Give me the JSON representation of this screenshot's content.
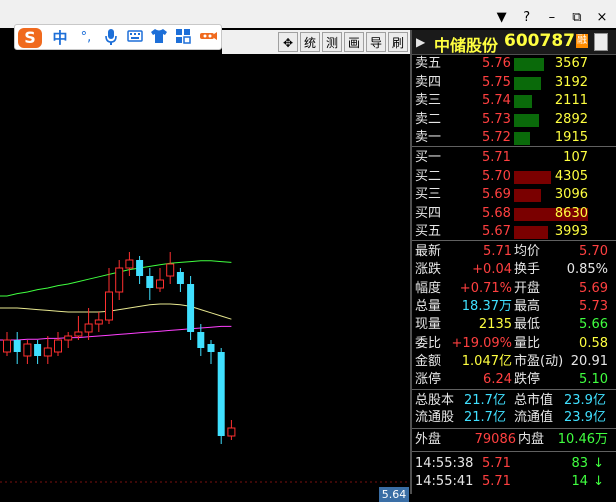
{
  "window": {
    "controls": [
      "▼",
      "?",
      "–",
      "⧉",
      "×"
    ]
  },
  "ime": {
    "logo": "S",
    "mode": "中",
    "punct": "°,",
    "mic": "mic-icon",
    "items": [
      "keyboard-icon",
      "shirt-icon",
      "grid-icon",
      "tool-icon"
    ]
  },
  "toolbar": {
    "buttons": [
      "✥",
      "统",
      "测",
      "画",
      "导",
      "刷"
    ]
  },
  "stock": {
    "name": "中储股份",
    "code": "600787",
    "badge": "融"
  },
  "order_book": {
    "asks": [
      {
        "label": "卖五",
        "price": "5.76",
        "vol": "3567",
        "fill": 0.41
      },
      {
        "label": "卖四",
        "price": "5.75",
        "vol": "3192",
        "fill": 0.37
      },
      {
        "label": "卖三",
        "price": "5.74",
        "vol": "2111",
        "fill": 0.24
      },
      {
        "label": "卖二",
        "price": "5.73",
        "vol": "2892",
        "fill": 0.34
      },
      {
        "label": "卖一",
        "price": "5.72",
        "vol": "1915",
        "fill": 0.22
      }
    ],
    "bids": [
      {
        "label": "买一",
        "price": "5.71",
        "vol": "107",
        "fill": 0.0
      },
      {
        "label": "买二",
        "price": "5.70",
        "vol": "4305",
        "fill": 0.5
      },
      {
        "label": "买三",
        "price": "5.69",
        "vol": "3096",
        "fill": 0.36
      },
      {
        "label": "买四",
        "price": "5.68",
        "vol": "8630",
        "fill": 1.0
      },
      {
        "label": "买五",
        "price": "5.67",
        "vol": "3993",
        "fill": 0.46
      }
    ]
  },
  "quote": {
    "rows": [
      {
        "l1": "最新",
        "v1": "5.71",
        "c1": "red",
        "l2": "均价",
        "v2": "5.70",
        "c2": "red"
      },
      {
        "l1": "涨跌",
        "v1": "+0.04",
        "c1": "red",
        "l2": "换手",
        "v2": "0.85%",
        "c2": "white"
      },
      {
        "l1": "幅度",
        "v1": "+0.71%",
        "c1": "red",
        "l2": "开盘",
        "v2": "5.69",
        "c2": "red"
      },
      {
        "l1": "总量",
        "v1": "18.37万",
        "c1": "cyan",
        "l2": "最高",
        "v2": "5.73",
        "c2": "red"
      },
      {
        "l1": "现量",
        "v1": "2135",
        "c1": "yellow",
        "l2": "最低",
        "v2": "5.66",
        "c2": "green"
      },
      {
        "l1": "委比",
        "v1": "+19.09%",
        "c1": "red",
        "l2": "量比",
        "v2": "0.58",
        "c2": "yellow"
      },
      {
        "l1": "金额",
        "v1": "1.047亿",
        "c1": "yellow",
        "l2": "市盈(动)",
        "v2": "20.91",
        "c2": "white"
      },
      {
        "l1": "涨停",
        "v1": "6.24",
        "c1": "red",
        "l2": "跌停",
        "v2": "5.10",
        "c2": "green"
      }
    ],
    "cap_rows": [
      {
        "l1": "总股本",
        "v1": "21.7亿",
        "l2": "总市值",
        "v2": "23.9亿"
      },
      {
        "l1": "流通股",
        "v1": "21.7亿",
        "l2": "流通值",
        "v2": "23.9亿"
      }
    ],
    "outer": {
      "label": "外盘",
      "value": "79086"
    },
    "inner": {
      "label": "内盘",
      "value": "10.46万"
    }
  },
  "ticks": [
    {
      "time": "14:55:38",
      "price": "5.71",
      "vol": "83",
      "arrow": "↓"
    },
    {
      "time": "14:55:41",
      "price": "5.71",
      "vol": "14",
      "arrow": "↓"
    }
  ],
  "chart_data": {
    "type": "candlestick",
    "current_price_label": "5.64",
    "ylim": [
      5.6,
      5.95
    ],
    "candles": [
      {
        "o": 5.765,
        "c": 5.78,
        "h": 5.79,
        "l": 5.76
      },
      {
        "o": 5.78,
        "c": 5.765,
        "h": 5.79,
        "l": 5.75
      },
      {
        "o": 5.76,
        "c": 5.775,
        "h": 5.78,
        "l": 5.75
      },
      {
        "o": 5.775,
        "c": 5.76,
        "h": 5.78,
        "l": 5.75
      },
      {
        "o": 5.76,
        "c": 5.77,
        "h": 5.785,
        "l": 5.75
      },
      {
        "o": 5.765,
        "c": 5.78,
        "h": 5.79,
        "l": 5.76
      },
      {
        "o": 5.78,
        "c": 5.785,
        "h": 5.79,
        "l": 5.77
      },
      {
        "o": 5.785,
        "c": 5.79,
        "h": 5.81,
        "l": 5.78
      },
      {
        "o": 5.79,
        "c": 5.8,
        "h": 5.82,
        "l": 5.78
      },
      {
        "o": 5.8,
        "c": 5.805,
        "h": 5.815,
        "l": 5.79
      },
      {
        "o": 5.805,
        "c": 5.84,
        "h": 5.87,
        "l": 5.8
      },
      {
        "o": 5.84,
        "c": 5.87,
        "h": 5.88,
        "l": 5.83
      },
      {
        "o": 5.87,
        "c": 5.88,
        "h": 5.89,
        "l": 5.86
      },
      {
        "o": 5.88,
        "c": 5.86,
        "h": 5.885,
        "l": 5.85
      },
      {
        "o": 5.86,
        "c": 5.845,
        "h": 5.87,
        "l": 5.83
      },
      {
        "o": 5.845,
        "c": 5.855,
        "h": 5.87,
        "l": 5.84
      },
      {
        "o": 5.86,
        "c": 5.875,
        "h": 5.89,
        "l": 5.85
      },
      {
        "o": 5.865,
        "c": 5.85,
        "h": 5.87,
        "l": 5.84
      },
      {
        "o": 5.85,
        "c": 5.79,
        "h": 5.86,
        "l": 5.78
      },
      {
        "o": 5.79,
        "c": 5.77,
        "h": 5.8,
        "l": 5.76
      },
      {
        "o": 5.775,
        "c": 5.765,
        "h": 5.78,
        "l": 5.75
      },
      {
        "o": 5.765,
        "c": 5.66,
        "h": 5.77,
        "l": 5.65
      },
      {
        "o": 5.66,
        "c": 5.67,
        "h": 5.68,
        "l": 5.655
      }
    ],
    "ma_lines": [
      {
        "color": "#40ff40",
        "values": [
          5.835,
          5.838,
          5.84,
          5.843,
          5.845,
          5.848,
          5.85,
          5.853,
          5.856,
          5.859,
          5.862,
          5.865,
          5.868,
          5.87,
          5.872,
          5.874,
          5.876,
          5.877,
          5.878,
          5.879,
          5.879,
          5.878,
          5.877
        ]
      },
      {
        "color": "#e8e890",
        "values": [
          5.82,
          5.82,
          5.819,
          5.818,
          5.817,
          5.816,
          5.815,
          5.815,
          5.815,
          5.815,
          5.816,
          5.818,
          5.82,
          5.822,
          5.824,
          5.825,
          5.825,
          5.824,
          5.822,
          5.818,
          5.814,
          5.81,
          5.806
        ]
      },
      {
        "color": "#ff40ff",
        "values": [
          5.78,
          5.78,
          5.781,
          5.781,
          5.782,
          5.782,
          5.783,
          5.783,
          5.784,
          5.785,
          5.786,
          5.787,
          5.788,
          5.789,
          5.79,
          5.791,
          5.792,
          5.793,
          5.794,
          5.795,
          5.796,
          5.797,
          5.797
        ]
      }
    ]
  }
}
